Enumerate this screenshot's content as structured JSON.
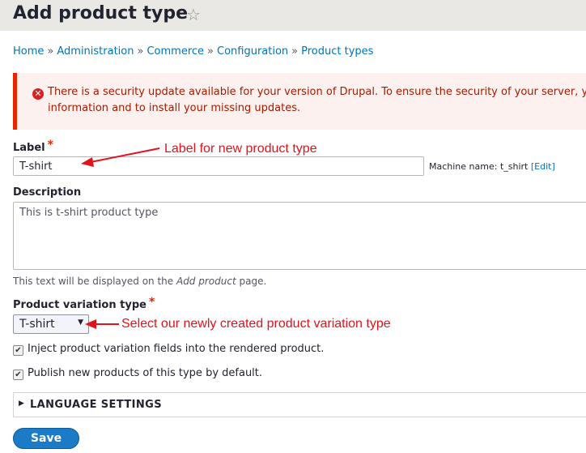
{
  "header": {
    "title": "Add product type",
    "star_icon": "star-outline-icon"
  },
  "breadcrumb": {
    "items": [
      "Home",
      "Administration",
      "Commerce",
      "Configuration",
      "Product types"
    ],
    "separator": "»"
  },
  "alert": {
    "icon": "error-circle-icon",
    "message": "There is a security update available for your version of Drupal. To ensure the security of your server, you should update immediately! See the available updates page for more information and to install your missing updates.",
    "line1": "There is a security update available for your version of Drupal. To ensure the security of your server, y",
    "line2": "information and to install your missing updates.",
    "colors": {
      "background": "#fdf1ef",
      "border": "#e62600",
      "text": "#a51b00"
    }
  },
  "form": {
    "label_field": {
      "label": "Label",
      "required_marker": "*",
      "value": "T-shirt",
      "machine_name_prefix": "Machine name: t_shirt",
      "machine_name_edit": "[Edit]"
    },
    "description_field": {
      "label": "Description",
      "value": "This is t-shirt product type",
      "help_prefix": "This text will be displayed on the ",
      "help_em": "Add product",
      "help_suffix": " page."
    },
    "variation_type_field": {
      "label": "Product variation type",
      "required_marker": "*",
      "selected": "T-shirt"
    },
    "checkboxes": [
      {
        "label": "Inject product variation fields into the rendered product.",
        "checked": true
      },
      {
        "label": "Publish new products of this type by default.",
        "checked": true
      }
    ],
    "language_settings": {
      "label": "LANGUAGE SETTINGS",
      "expanded": false
    },
    "save_label": "Save"
  },
  "annotations": {
    "label_note": "Label for new product type",
    "variation_note": "Select our newly created product variation type",
    "color": "#e0141c"
  }
}
